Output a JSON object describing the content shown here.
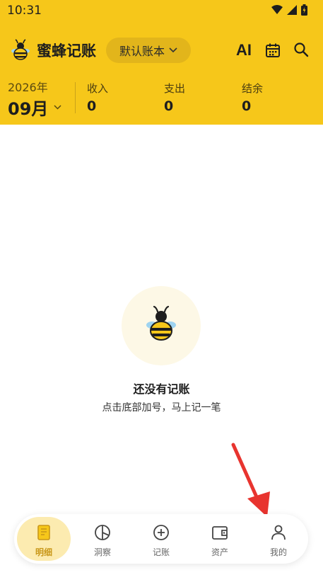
{
  "status": {
    "time": "10:31"
  },
  "header": {
    "app_title": "蜜蜂记账",
    "book_selector": "默认账本",
    "ai_label": "AI"
  },
  "summary": {
    "year": "2026年",
    "month": "09月",
    "income_label": "收入",
    "income_value": "0",
    "expense_label": "支出",
    "expense_value": "0",
    "balance_label": "结余",
    "balance_value": "0"
  },
  "empty_state": {
    "title": "还没有记账",
    "subtitle": "点击底部加号，马上记一笔"
  },
  "bottom_nav": [
    {
      "label": "明细",
      "icon": "ledger-icon",
      "active": true
    },
    {
      "label": "洞察",
      "icon": "pie-chart-icon"
    },
    {
      "label": "记账",
      "icon": "add-circle-icon"
    },
    {
      "label": "资产",
      "icon": "wallet-icon"
    },
    {
      "label": "我的",
      "icon": "user-icon"
    }
  ],
  "colors": {
    "brand_yellow": "#F6C71A",
    "active_text": "#C9981A",
    "arrow": "#E8342F"
  }
}
